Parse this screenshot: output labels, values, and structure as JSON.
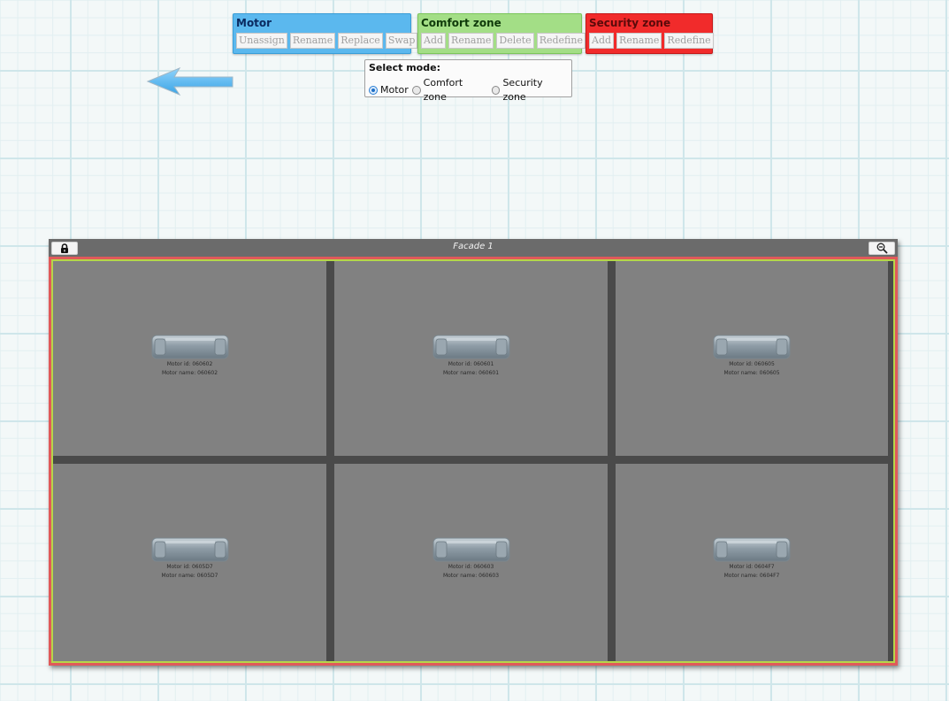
{
  "toolbar": {
    "motor": {
      "title": "Motor",
      "buttons": [
        "Unassign",
        "Rename",
        "Replace",
        "Swap"
      ]
    },
    "comfort_zone": {
      "title": "Comfort zone",
      "buttons": [
        "Add",
        "Rename",
        "Delete",
        "Redefine"
      ]
    },
    "security_zone": {
      "title": "Security zone",
      "buttons": [
        "Add",
        "Rename",
        "Redefine"
      ]
    }
  },
  "mode_select": {
    "title": "Select mode:",
    "options": [
      "Motor",
      "Comfort zone",
      "Security zone"
    ],
    "selected": "Motor"
  },
  "facade": {
    "title": "Facade 1",
    "motors": [
      {
        "id_label": "Motor id: 060602",
        "name_label": "Motor name: 060602"
      },
      {
        "id_label": "Motor id: 060601",
        "name_label": "Motor name: 060601"
      },
      {
        "id_label": "Motor id: 060605",
        "name_label": "Motor name: 060605"
      },
      {
        "id_label": "Motor id: 0605D7",
        "name_label": "Motor name: 0605D7"
      },
      {
        "id_label": "Motor id: 060603",
        "name_label": "Motor name: 060603"
      },
      {
        "id_label": "Motor id: 0604F7",
        "name_label": "Motor name: 0604F7"
      }
    ]
  },
  "icons": {
    "back": "arrow-left-icon",
    "lock": "lock-icon",
    "zoom": "zoom-out-icon",
    "motor": "motor-icon"
  },
  "colors": {
    "motor_group": "#5bb8ee",
    "comfort_group": "#a3de86",
    "security_group": "#f12b2b",
    "arrow": "#5bbaf0",
    "security_border": "#e05a5a",
    "comfort_border": "#b5d64a"
  }
}
